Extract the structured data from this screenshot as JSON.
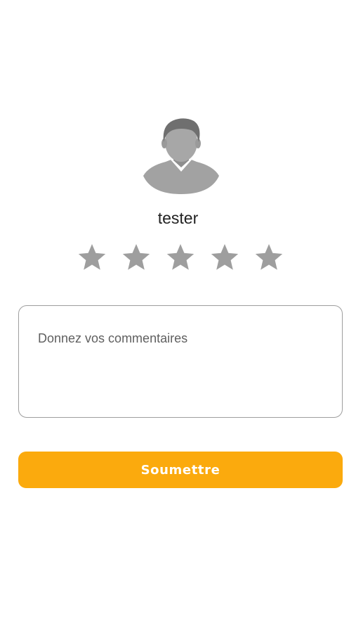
{
  "profile": {
    "avatar_icon": "person-avatar-icon",
    "name": "tester"
  },
  "rating": {
    "max": 5,
    "value": 0,
    "star_icon": "star-icon",
    "inactive_color": "#9e9e9e"
  },
  "comment": {
    "placeholder": "Donnez vos commentaires",
    "value": ""
  },
  "submit": {
    "label": "Soumettre",
    "color": "#fbaa0d"
  }
}
